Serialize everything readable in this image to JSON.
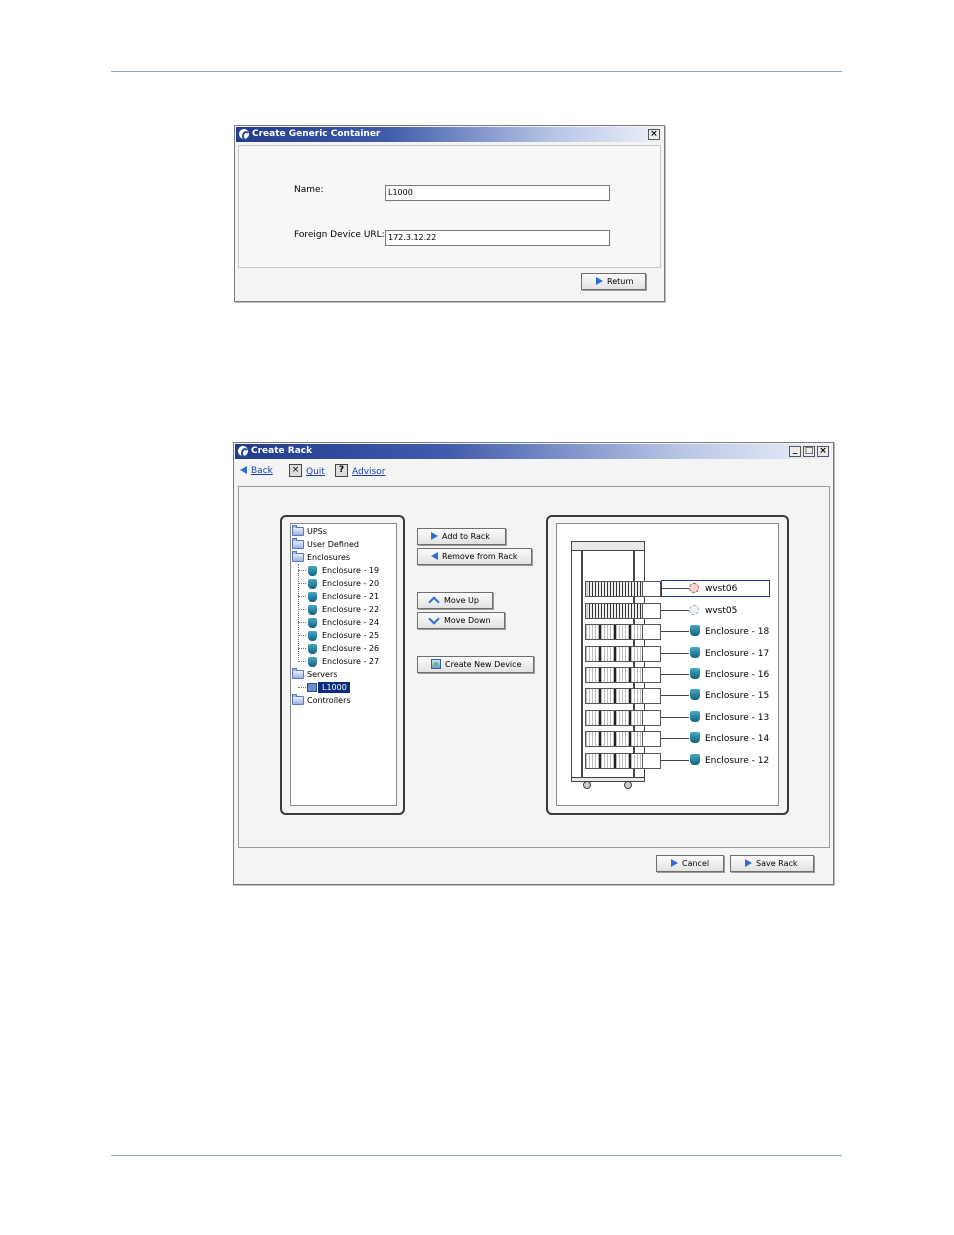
{
  "dialog1": {
    "title": "Create Generic Container",
    "close_glyph": "×",
    "name_label": "Name:",
    "name_value": "L1000",
    "url_label": "Foreign Device URL:",
    "url_value": "172.3.12.22",
    "return_label": "Return"
  },
  "dialog2": {
    "title": "Create Rack",
    "window_controls": {
      "minimize": "_",
      "maximize": "□",
      "close": "×"
    },
    "toolbar": {
      "back": "Back",
      "quit": "Quit",
      "advisor": "Advisor",
      "quit_glyph": "×",
      "advisor_glyph": "?"
    },
    "tree": {
      "ups": "UPSs",
      "user_defined": "User Defined",
      "enclosures": "Enclosures",
      "enclosure_items": [
        "Enclosure - 19",
        "Enclosure - 20",
        "Enclosure - 21",
        "Enclosure - 22",
        "Enclosure - 24",
        "Enclosure - 25",
        "Enclosure - 26",
        "Enclosure - 27"
      ],
      "servers": "Servers",
      "server_items": [
        "L1000"
      ],
      "controllers": "Controllers"
    },
    "actions": {
      "add_to_rack": "Add to Rack",
      "remove_from_rack": "Remove from Rack",
      "move_up": "Move Up",
      "move_down": "Move Down",
      "create_new_device": "Create New Device"
    },
    "rack_devices": [
      "wvst06",
      "wvst05",
      "Enclosure - 18",
      "Enclosure - 17",
      "Enclosure - 16",
      "Enclosure - 15",
      "Enclosure - 13",
      "Enclosure - 14",
      "Enclosure - 12"
    ],
    "cancel_label": "Cancel",
    "save_label": "Save Rack"
  }
}
